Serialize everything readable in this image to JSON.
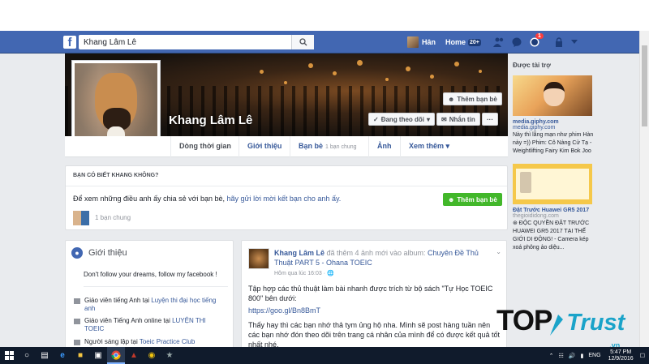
{
  "topbar": {
    "logo": "f",
    "search_value": "Khang Lâm Lê",
    "user_name": "Hân",
    "home_label": "Home",
    "home_count": "20+",
    "notif_count": "1"
  },
  "profile": {
    "name": "Khang Lâm Lê",
    "add_friend_label": "Thêm bạn bè",
    "following_label": "Đang theo dõi",
    "message_label": "Nhắn tin",
    "more_label": "···"
  },
  "tabs": [
    {
      "label": "Dòng thời gian"
    },
    {
      "label": "Giới thiệu"
    },
    {
      "label": "Bạn bè",
      "sub": "1 bạn chung"
    },
    {
      "label": "Ảnh"
    },
    {
      "label": "Xem thêm"
    }
  ],
  "know": {
    "title": "BẠN CÓ BIẾT KHANG KHÔNG?",
    "text": "Để xem những điều anh ấy chia sẻ với bạn bè, ",
    "link": "hãy gửi lời mời kết bạn cho anh ấy.",
    "mutual": "1 bạn chung",
    "add_friend_label": "Thêm bạn bè"
  },
  "intro": {
    "title": "Giới thiệu",
    "quote": "Don't follow your dreams, follow my facebook !",
    "items": [
      {
        "text": "Giáo viên tiếng Anh tại ",
        "link": "Luyện thi đại học tiếng anh"
      },
      {
        "text": "Giáo viên Tiếng Anh online tại ",
        "link": "LUYỆN THI TOEIC"
      },
      {
        "text": "Người sáng lập tại ",
        "link": "Toeic Practice Club"
      }
    ]
  },
  "post": {
    "author": "Khang Lâm Lê",
    "action": " đã thêm 4 ảnh mới vào album: ",
    "album": "Chuyên Đề Thủ Thuật PART 5 - Ohana TOEIC",
    "time": "Hôm qua lúc 16:03 · ",
    "body1": "Tập hợp các thủ thuật làm bài nhanh được trích từ bộ sách \"Tự Học TOEIC 800\" bên dưới:",
    "link": "https://goo.gl/Bn8BmT",
    "body2": "Thấy hay thì các bạn nhớ thả tym ủng hộ nha. Mình sẽ post hàng tuần nên các bạn nhớ đón theo dõi trên trang cá nhân của mình để có được kết quả tốt nhất nhé."
  },
  "ads": {
    "title": "Được tài trợ",
    "ad1_title": "media.giphy.com",
    "ad1_domain": "media.giphy.com",
    "ad1_desc": "Này thì lẵng mạn như phim Hàn này =)) Phim: Cô Nàng Cử Tạ - Weightlifting Fairy Kim Bok Joo",
    "ad2_title": "Đặt Trước Huawei GR5 2017",
    "ad2_domain": "thegioididong.com",
    "ad2_desc": "⊛ ĐỘC QUYỀN ĐẶT TRƯỚC HUAWEI GR5 2017 TẠI THẾ GIỚI DI ĐỘNG! - Camera kép xoá phông ảo diệu..."
  },
  "watermark": {
    "top": "TOP",
    "trust": "Trust",
    "vn": ".vn"
  },
  "taskbar": {
    "lang": "ENG",
    "time": "5:47 PM",
    "date": "12/9/2016"
  }
}
